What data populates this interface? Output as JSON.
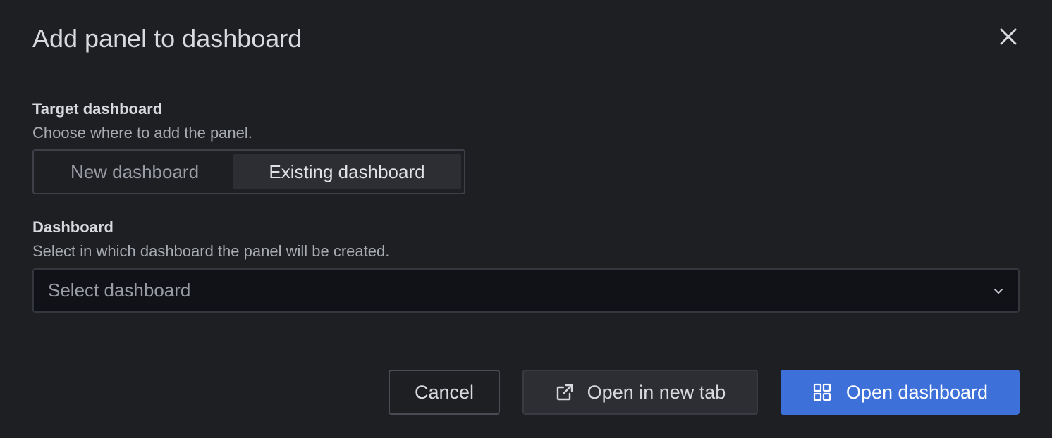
{
  "modal": {
    "title": "Add panel to dashboard"
  },
  "target_dashboard": {
    "label": "Target dashboard",
    "description": "Choose where to add the panel.",
    "options": [
      {
        "label": "New dashboard",
        "selected": false
      },
      {
        "label": "Existing dashboard",
        "selected": true
      }
    ]
  },
  "dashboard": {
    "label": "Dashboard",
    "description": "Select in which dashboard the panel will be created.",
    "placeholder": "Select dashboard"
  },
  "actions": {
    "cancel_label": "Cancel",
    "new_tab_label": "Open in new tab",
    "open_label": "Open dashboard"
  },
  "icons": {
    "close": "close-icon",
    "chevron": "chevron-down-icon",
    "external": "external-link-icon",
    "apps": "apps-grid-icon"
  },
  "colors": {
    "background": "#1e1f23",
    "primary": "#3d71d9",
    "input_bg": "#111217"
  }
}
